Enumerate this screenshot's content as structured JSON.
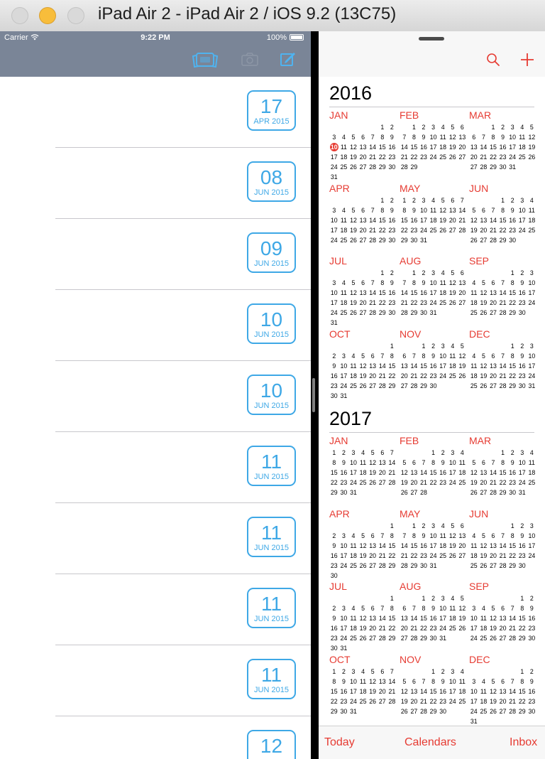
{
  "window": {
    "title": "iPad Air 2 - iPad Air 2 / iOS 9.2 (13C75)"
  },
  "status_bar": {
    "carrier": "Carrier",
    "time": "9:22 PM",
    "battery": "100%"
  },
  "left_app": {
    "nav_icons": [
      "cards-icon",
      "camera-icon",
      "compose-icon"
    ],
    "rows": [
      {
        "day": "17",
        "month": "APR 2015"
      },
      {
        "day": "08",
        "month": "JUN 2015"
      },
      {
        "day": "09",
        "month": "JUN 2015"
      },
      {
        "day": "10",
        "month": "JUN 2015"
      },
      {
        "day": "10",
        "month": "JUN 2015"
      },
      {
        "day": "11",
        "month": "JUN 2015"
      },
      {
        "day": "11",
        "month": "JUN 2015"
      },
      {
        "day": "11",
        "month": "JUN 2015"
      },
      {
        "day": "11",
        "month": "JUN 2015"
      },
      {
        "day": "12",
        "month": ""
      }
    ]
  },
  "calendar": {
    "accent_color": "#e63b32",
    "today": {
      "year": "2016",
      "month": "JAN",
      "day": 10
    },
    "years": [
      {
        "year": "2016",
        "months": [
          {
            "name": "JAN",
            "offset": 5,
            "days": 31
          },
          {
            "name": "FEB",
            "offset": 1,
            "days": 29
          },
          {
            "name": "MAR",
            "offset": 2,
            "days": 31
          },
          {
            "name": "APR",
            "offset": 5,
            "days": 30
          },
          {
            "name": "MAY",
            "offset": 0,
            "days": 31
          },
          {
            "name": "JUN",
            "offset": 3,
            "days": 30
          },
          {
            "name": "JUL",
            "offset": 5,
            "days": 31
          },
          {
            "name": "AUG",
            "offset": 1,
            "days": 31
          },
          {
            "name": "SEP",
            "offset": 4,
            "days": 30
          },
          {
            "name": "OCT",
            "offset": 6,
            "days": 31
          },
          {
            "name": "NOV",
            "offset": 2,
            "days": 30
          },
          {
            "name": "DEC",
            "offset": 4,
            "days": 31
          }
        ]
      },
      {
        "year": "2017",
        "months": [
          {
            "name": "JAN",
            "offset": 0,
            "days": 31
          },
          {
            "name": "FEB",
            "offset": 3,
            "days": 28
          },
          {
            "name": "MAR",
            "offset": 3,
            "days": 31
          },
          {
            "name": "APR",
            "offset": 6,
            "days": 30
          },
          {
            "name": "MAY",
            "offset": 1,
            "days": 31
          },
          {
            "name": "JUN",
            "offset": 4,
            "days": 30
          },
          {
            "name": "JUL",
            "offset": 6,
            "days": 31
          },
          {
            "name": "AUG",
            "offset": 2,
            "days": 31
          },
          {
            "name": "SEP",
            "offset": 5,
            "days": 30
          },
          {
            "name": "OCT",
            "offset": 0,
            "days": 31
          },
          {
            "name": "NOV",
            "offset": 3,
            "days": 30
          },
          {
            "name": "DEC",
            "offset": 5,
            "days": 31
          }
        ]
      }
    ],
    "toolbar_icons": [
      "search-icon",
      "add-icon"
    ],
    "tabs": {
      "today": "Today",
      "calendars": "Calendars",
      "inbox": "Inbox"
    }
  }
}
